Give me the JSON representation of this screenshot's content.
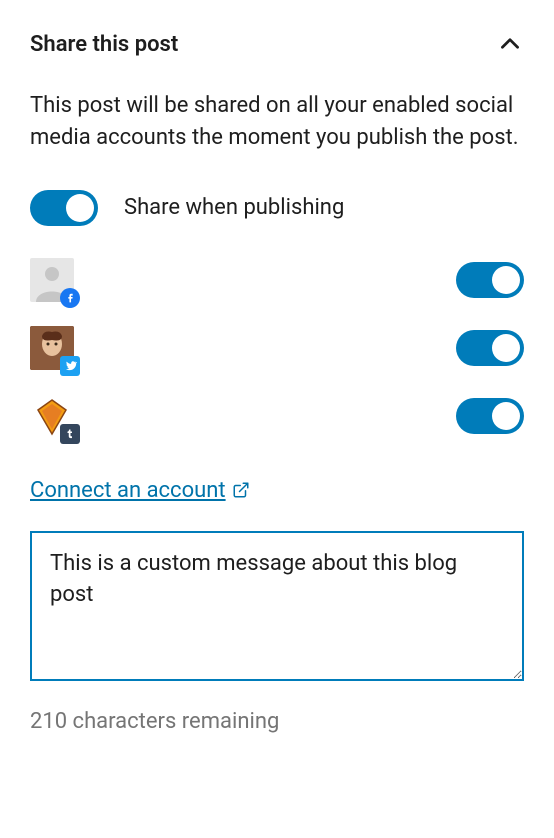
{
  "panel": {
    "title": "Share this post",
    "description": "This post will be shared on all your enabled social media accounts the moment you publish the post.",
    "master_toggle": {
      "label": "Share when publishing",
      "on": true
    },
    "accounts": [
      {
        "network": "facebook",
        "enabled": true
      },
      {
        "network": "twitter",
        "enabled": true
      },
      {
        "network": "tumblr",
        "enabled": true
      }
    ],
    "connect_link": "Connect an account",
    "custom_message": "This is a custom message about this blog post",
    "char_remaining": "210 characters remaining"
  },
  "colors": {
    "accent": "#007cba",
    "link": "#0073aa",
    "muted": "#757575"
  }
}
